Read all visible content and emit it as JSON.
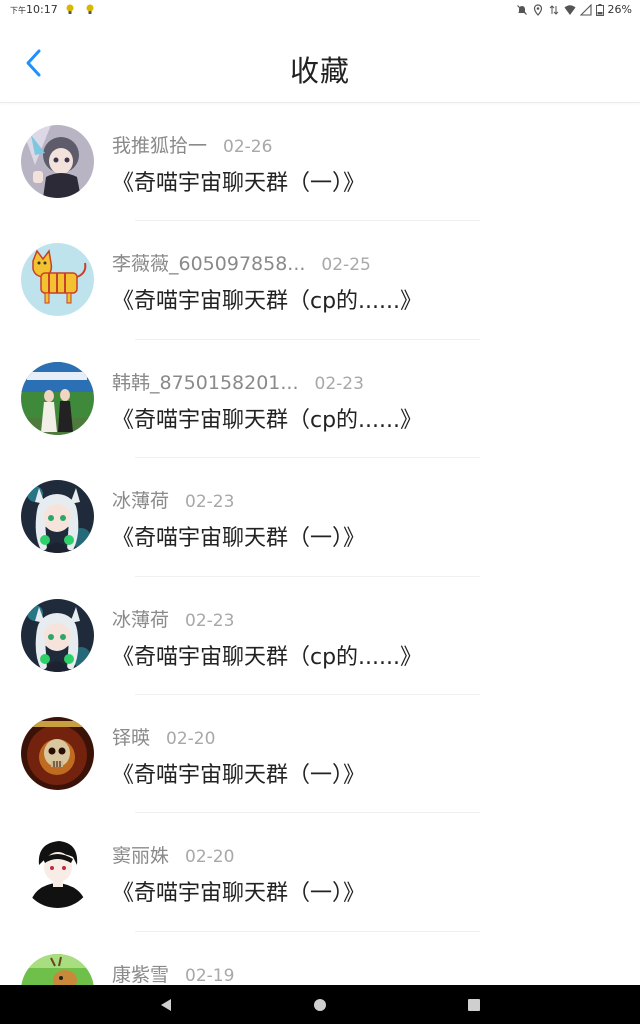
{
  "status_bar": {
    "ampm": "下午",
    "time": "10:17",
    "battery": "26%"
  },
  "header": {
    "title": "收藏"
  },
  "items": [
    {
      "author": "我推狐拾一",
      "date": "02-26",
      "title": "《奇喵宇宙聊天群（一）》",
      "avatar": "anime-girl-gray"
    },
    {
      "author": "李薇薇_605097858...",
      "date": "02-25",
      "title": "《奇喵宇宙聊天群（cp的......》",
      "avatar": "yellow-cat-drawing"
    },
    {
      "author": "韩韩_8750158201...",
      "date": "02-23",
      "title": "《奇喵宇宙聊天群（cp的......》",
      "avatar": "two-people-photo"
    },
    {
      "author": "冰薄荷",
      "date": "02-23",
      "title": "《奇喵宇宙聊天群（一）》",
      "avatar": "anime-cat-girl"
    },
    {
      "author": "冰薄荷",
      "date": "02-23",
      "title": "《奇喵宇宙聊天群（cp的......》",
      "avatar": "anime-cat-girl"
    },
    {
      "author": "铎暎",
      "date": "02-20",
      "title": "《奇喵宇宙聊天群（一）》",
      "avatar": "skull-poster"
    },
    {
      "author": "窦丽姝",
      "date": "02-20",
      "title": "《奇喵宇宙聊天群（一）》",
      "avatar": "anime-boy-black"
    },
    {
      "author": "康紫雪",
      "date": "02-19",
      "title": "",
      "avatar": "deer-illustration"
    }
  ],
  "colors": {
    "accent": "#1e90ff",
    "author_text": "#8a8a8a",
    "date_text": "#a8a8a8",
    "title_text": "#222222"
  }
}
